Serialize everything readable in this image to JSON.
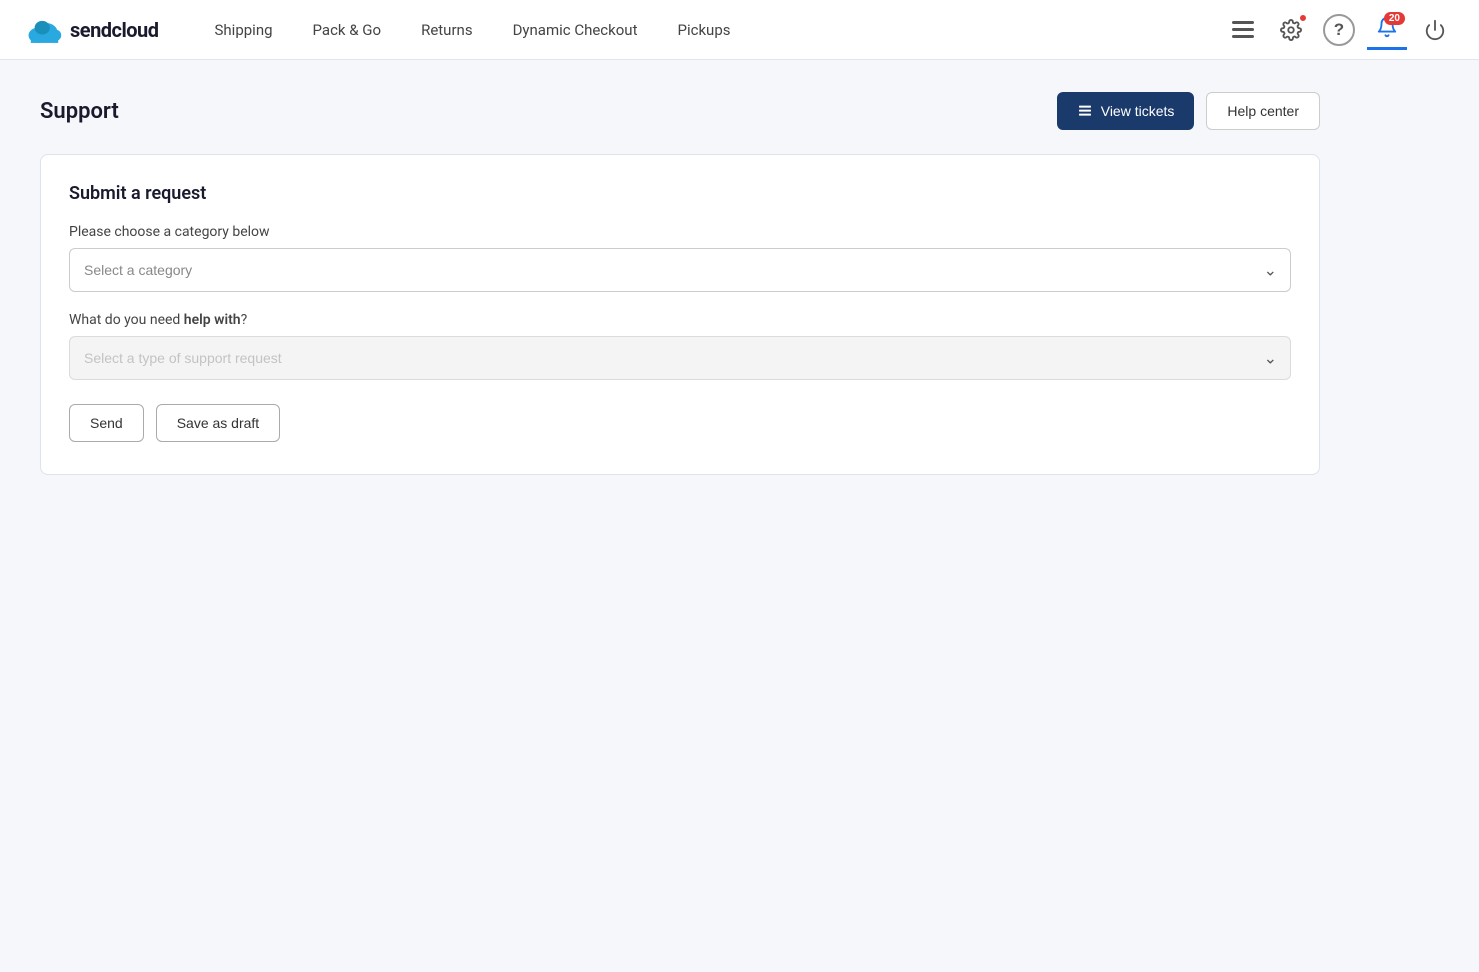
{
  "app": {
    "logo_text": "sendcloud"
  },
  "navbar": {
    "items": [
      {
        "label": "Shipping",
        "id": "shipping"
      },
      {
        "label": "Pack & Go",
        "id": "pack-go"
      },
      {
        "label": "Returns",
        "id": "returns"
      },
      {
        "label": "Dynamic Checkout",
        "id": "dynamic-checkout"
      },
      {
        "label": "Pickups",
        "id": "pickups"
      }
    ]
  },
  "nav_icons": {
    "list_icon": "≡",
    "settings_icon": "⚙",
    "help_icon": "?",
    "notifications_icon": "🔔",
    "power_icon": "⏻",
    "notifications_badge": "20"
  },
  "page": {
    "title": "Support"
  },
  "header_buttons": {
    "view_tickets": "View tickets",
    "help_center": "Help center"
  },
  "form": {
    "title": "Submit a request",
    "category_label": "Please choose a category below",
    "category_placeholder": "Select a category",
    "help_label_prefix": "What do you need ",
    "help_label_bold": "help with",
    "help_label_suffix": "?",
    "help_placeholder": "Select a type of support request",
    "send_label": "Send",
    "draft_label": "Save as draft"
  }
}
